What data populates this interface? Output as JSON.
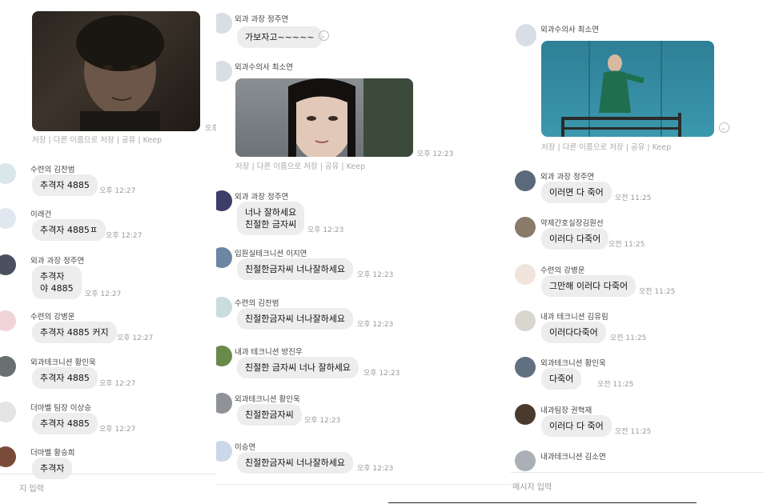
{
  "panel1": {
    "photo_save_bar": "저장 | 다른 이름으로 저장 | 공유 | Keep",
    "photo_time": "오후",
    "messages": [
      {
        "name": "수련의 김찬범",
        "text": "추격자 4885",
        "time": "오후 12:27"
      },
      {
        "name": "이래건",
        "text": "추격자 4885ㅍ",
        "time": "오후 12:27"
      },
      {
        "name": "외과 과장 정주연",
        "text": "추격자\n야 4885",
        "time": "오후 12:27"
      },
      {
        "name": "수련의 강병운",
        "text": "추격자 4885 커지",
        "time": "오후 12:27"
      },
      {
        "name": "외과테크니션 황인욱",
        "text": "추격자 4885",
        "time": "오후 12:27"
      },
      {
        "name": "더마벨 팀장 이상승",
        "text": "추격자 4885",
        "time": "오후 12:27"
      },
      {
        "name": "더마벨 황승희",
        "text": "추격자",
        "time": ""
      }
    ],
    "input_placeholder": "지 입력"
  },
  "panel2": {
    "first": {
      "name": "외과 과장 정주연",
      "text": "가보자고~~~~~"
    },
    "photo": {
      "name": "외과수의사 최소연",
      "time": "오후 12:23",
      "save_bar": "저장 | 다른 이름으로 저장 | 공유 | Keep"
    },
    "messages": [
      {
        "name": "외과 과장 정주연",
        "text": "너나 잘하세요\n친절한 금자씨",
        "time": "오후 12:23"
      },
      {
        "name": "입원실테크니션 이지연",
        "text": "친절한금자씨 너나잘하세요",
        "time": "오후 12:23"
      },
      {
        "name": "수련의 김찬범",
        "text": "친절한금자씨 너나잘하세요",
        "time": "오후 12:23"
      },
      {
        "name": "내과 테크니션 방진우",
        "text": "친절한 금자씨 너나 잘하세요",
        "time": "오후 12:23"
      },
      {
        "name": "외과테크니션 황인욱",
        "text": "친절한금자씨",
        "time": "오후 12:23"
      },
      {
        "name": "이승연",
        "text": "친절한금자씨 너나잘하세요",
        "time": "오후 12:23"
      }
    ]
  },
  "panel3": {
    "photo": {
      "name": "외과수의사 최소연",
      "save_bar": "저장 | 다른 이름으로 저장 | 공유 | Keep"
    },
    "messages": [
      {
        "name": "외과 과장 정주연",
        "text": "이러면 다 죽어",
        "time": "오전 11:25"
      },
      {
        "name": "약제간호실장김원선",
        "text": "이러다 다죽어",
        "time": "오전 11:25"
      },
      {
        "name": "수련의 강병운",
        "text": "그만해 이러다 다죽어",
        "time": "오전 11:25"
      },
      {
        "name": "내과 테크니션 김유림",
        "text": "이러다다죽어",
        "time": "오전 11:25"
      },
      {
        "name": "외과테크니션 황인욱",
        "text": "다죽어",
        "time": "오전 11:25"
      },
      {
        "name": "내과팀장 권혁재",
        "text": "이러다 다 죽어",
        "time": "오전 11:25"
      },
      {
        "name": "내과테크니션 김소연",
        "text": "",
        "time": ""
      }
    ],
    "input_placeholder": "메시지 입력"
  }
}
